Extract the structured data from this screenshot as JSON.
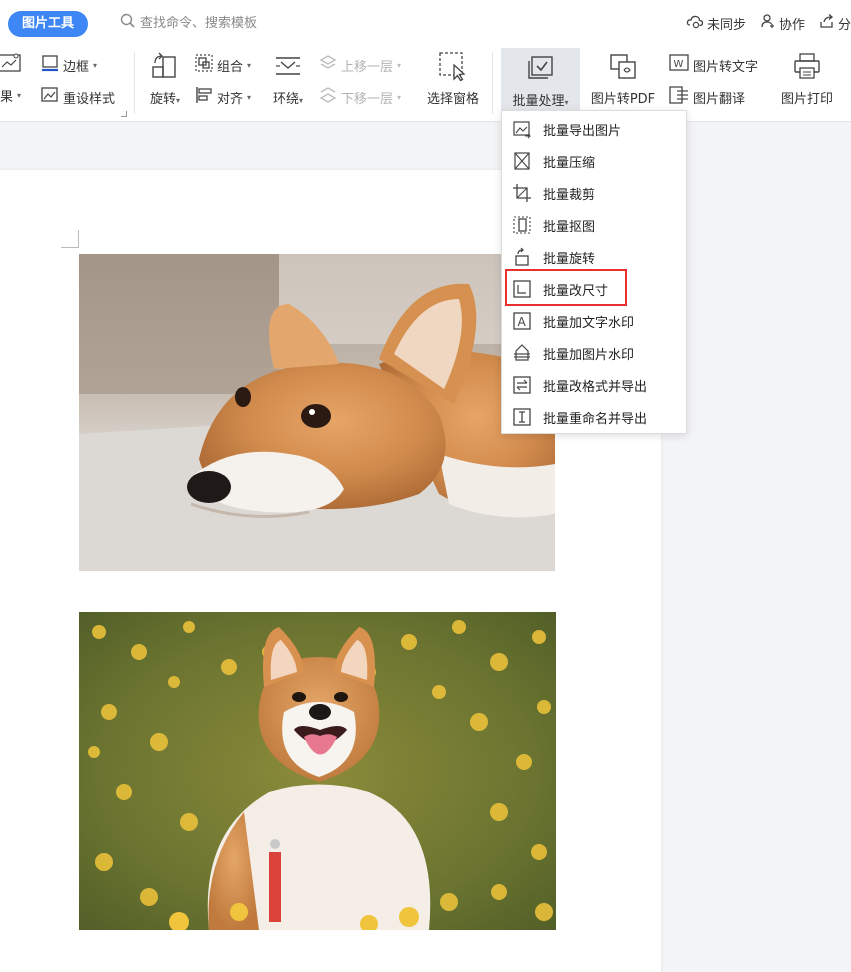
{
  "header": {
    "tool_tab": "图片工具",
    "search_placeholder": "查找命令、搜索模板",
    "sync_label": "未同步",
    "collab_label": "协作",
    "share_label": "分"
  },
  "ribbon": {
    "effects_label": "效果",
    "border_label": "边框",
    "reset_style_label": "重设样式",
    "rotate_label": "旋转",
    "group_label": "组合",
    "align_label": "对齐",
    "wrap_label": "环绕",
    "bring_forward_label": "上移一层",
    "send_backward_label": "下移一层",
    "selection_pane_label": "选择窗格",
    "batch_label": "批量处理",
    "to_pdf_label": "图片转PDF",
    "to_text_label": "图片转文字",
    "translate_label": "图片翻译",
    "print_label": "图片打印"
  },
  "dropdown": {
    "items": [
      {
        "label": "批量导出图片",
        "icon": "export-image-icon"
      },
      {
        "label": "批量压缩",
        "icon": "compress-icon"
      },
      {
        "label": "批量裁剪",
        "icon": "crop-icon"
      },
      {
        "label": "批量抠图",
        "icon": "cutout-icon"
      },
      {
        "label": "批量旋转",
        "icon": "rotate-icon"
      },
      {
        "label": "批量改尺寸",
        "icon": "resize-icon"
      },
      {
        "label": "批量加文字水印",
        "icon": "text-watermark-icon"
      },
      {
        "label": "批量加图片水印",
        "icon": "image-watermark-icon"
      },
      {
        "label": "批量改格式并导出",
        "icon": "format-convert-icon"
      },
      {
        "label": "批量重命名并导出",
        "icon": "rename-icon"
      }
    ],
    "highlighted": "批量改尺寸"
  },
  "colors": {
    "accent": "#3d86f4",
    "highlight": "#e8312f",
    "active_bg": "#e3e6ea"
  }
}
